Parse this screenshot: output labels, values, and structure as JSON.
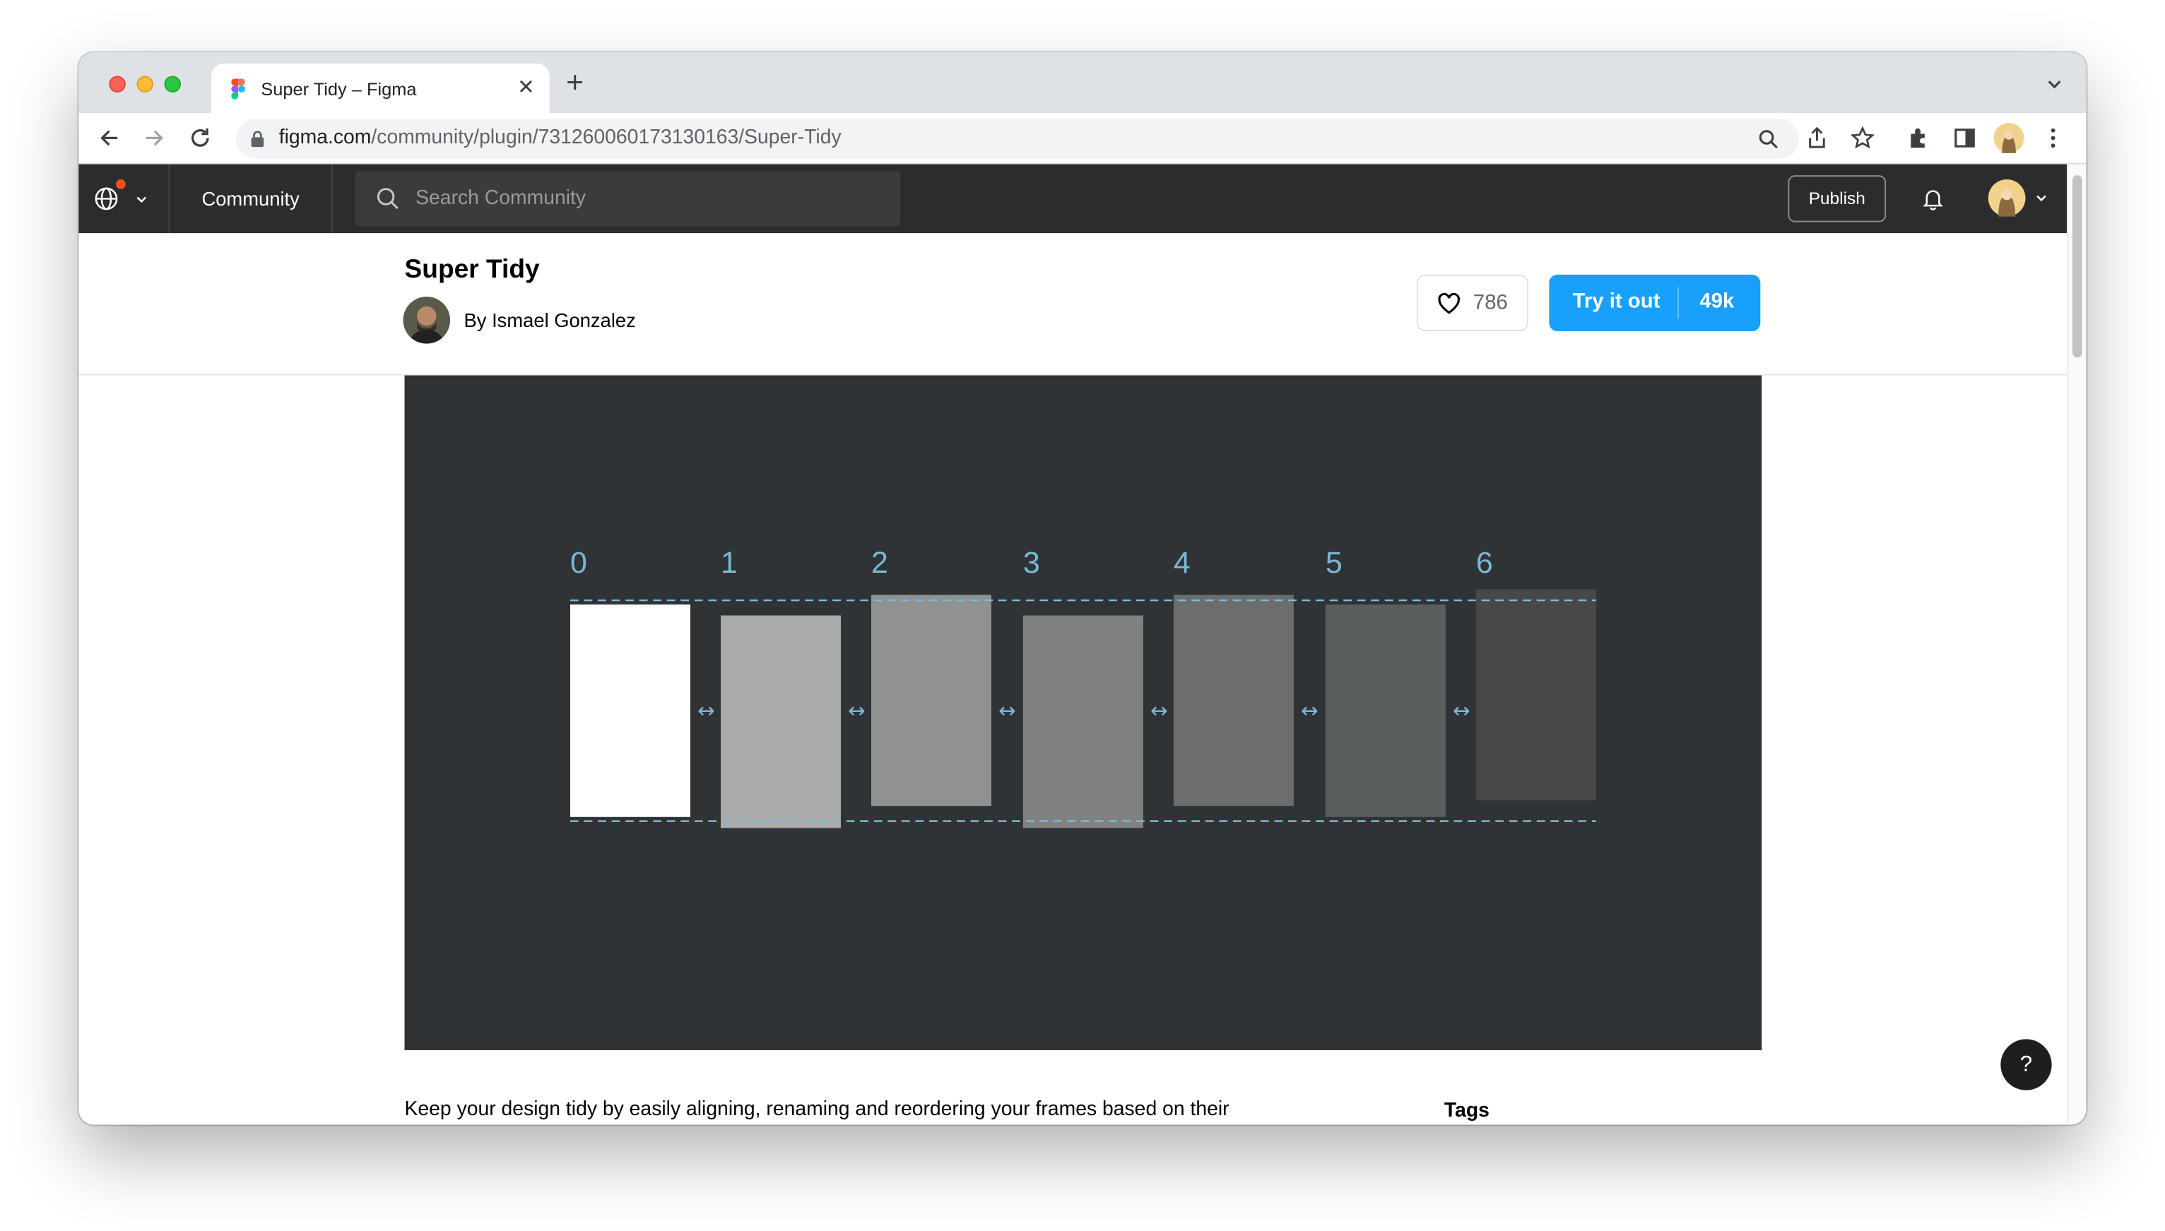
{
  "browser": {
    "tab_title": "Super Tidy – Figma",
    "tab_close_glyph": "✕",
    "new_tab_glyph": "+",
    "url_domain": "figma.com",
    "url_path": "/community/plugin/731260060173130163/Super-Tidy",
    "icons": [
      "back-icon",
      "forward-icon",
      "reload-icon",
      "lock-icon",
      "zoom-icon",
      "share-icon",
      "bookmark-star-icon",
      "extensions-icon",
      "sidepanel-icon",
      "profile-avatar",
      "more-vert-icon",
      "tab-menu-chevron-icon"
    ]
  },
  "figma_header": {
    "community_label": "Community",
    "search_placeholder": "Search Community",
    "publish_label": "Publish",
    "notification_dot_color": "#f24e1e"
  },
  "plugin": {
    "title": "Super Tidy",
    "author": "By Ismael Gonzalez",
    "likes": "786",
    "try_label": "Try it out",
    "uses": "49k",
    "description": "Keep your design tidy by easily aligning, renaming and reordering your frames based on their",
    "tags_heading": "Tags"
  },
  "hero": {
    "background": "#303335",
    "accent": "#7ab8d6",
    "indices": [
      "0",
      "1",
      "2",
      "3",
      "4",
      "5",
      "6"
    ],
    "spacing_glyph": "↔",
    "frame_fills": [
      "#ffffff",
      "#a9abab",
      "#909292",
      "#808282",
      "#6c6e6e",
      "#5b5e5e",
      "#474949"
    ]
  },
  "help": {
    "label": "?"
  },
  "colors": {
    "try_button": "#18a0fb",
    "figma_header": "#2c2c2c"
  }
}
